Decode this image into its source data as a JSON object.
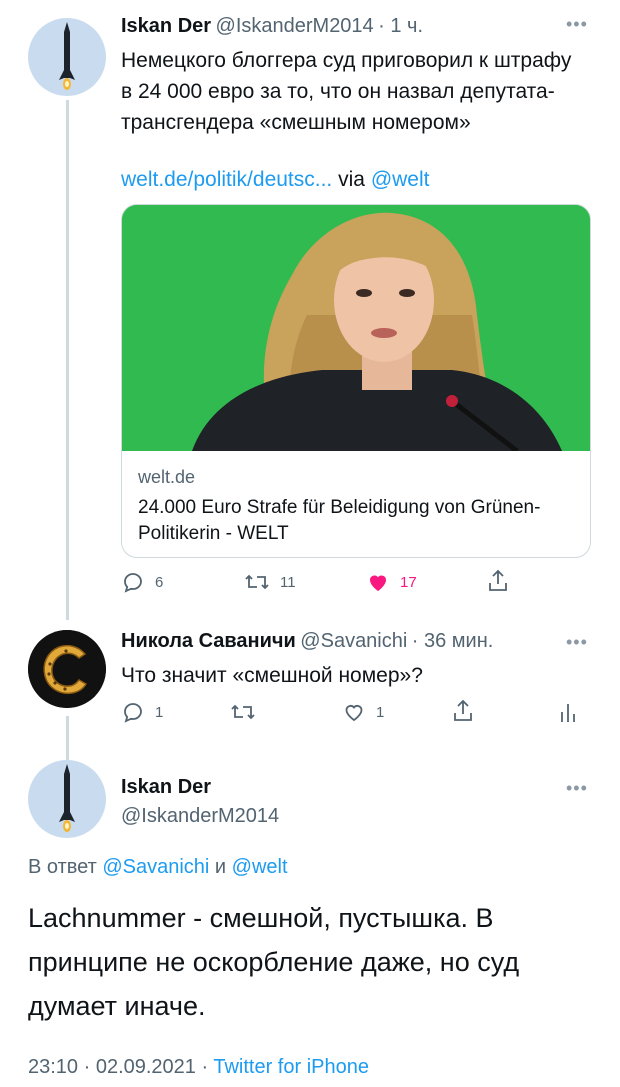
{
  "tweet1": {
    "name": "Iskan Der",
    "handle": "@IskanderM2014",
    "time": "· 1 ч.",
    "text": "Немецкого блоггера суд приговорил к штрафу в 24 000 евро за то, что он назвал депутата-трансгендера «смешным номером»",
    "link": "welt.de/politik/deutsc...",
    "via_label": "via",
    "via_handle": "@welt",
    "card": {
      "domain": "welt.de",
      "title": "24.000 Euro Strafe für Beleidigung von Grünen-Politikerin - WELT"
    },
    "actions": {
      "replies": "6",
      "retweets": "11",
      "likes": "17"
    }
  },
  "tweet2": {
    "name": "Никола Саваничи",
    "handle": "@Savanichi",
    "time": "· 36 мин.",
    "text": "Что значит «смешной номер»?",
    "actions": {
      "replies": "1",
      "retweets": "",
      "likes": "1"
    }
  },
  "tweet3": {
    "name": "Iskan Der",
    "handle": "@IskanderM2014",
    "reply_prefix": "В ответ",
    "reply_to_1": "@Savanichi",
    "reply_and": "и",
    "reply_to_2": "@welt",
    "text": "Lachnummer - смешной, пустышка. В принципе не оскорбление даже, но суд думает иначе.",
    "timestamp": "23:10 · 02.09.2021 ·",
    "source": "Twitter for iPhone"
  },
  "colors": {
    "accent": "#1d9bf0",
    "like": "#f91880",
    "muted": "#536471"
  }
}
